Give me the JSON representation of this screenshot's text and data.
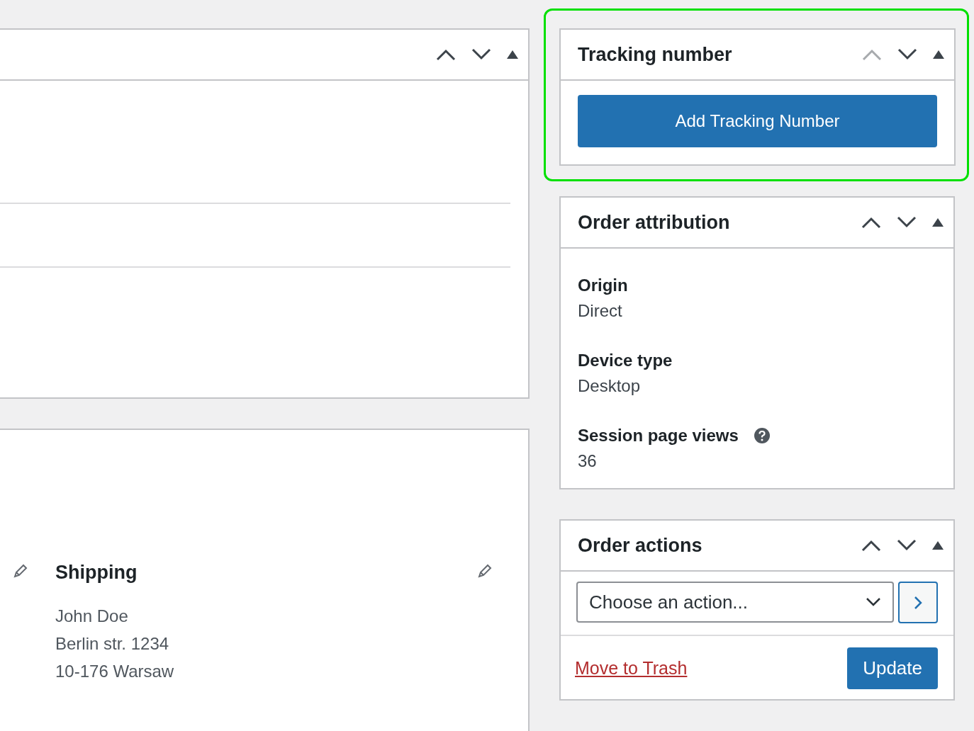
{
  "order_panel": {
    "move_up_disabled": false
  },
  "address_panel": {
    "shipping": {
      "heading": "Shipping",
      "lines": [
        "John Doe",
        "Berlin str. 1234",
        "10-176 Warsaw"
      ]
    }
  },
  "tracking": {
    "title": "Tracking number",
    "highlighted": true,
    "move_up_disabled": true,
    "button": "Add Tracking Number"
  },
  "attribution": {
    "title": "Order attribution",
    "move_up_disabled": false,
    "fields": [
      {
        "label": "Origin",
        "value": "Direct",
        "help": false
      },
      {
        "label": "Device type",
        "value": "Desktop",
        "help": false
      },
      {
        "label": "Session page views",
        "value": "36",
        "help": true
      }
    ]
  },
  "actions": {
    "title": "Order actions",
    "move_up_disabled": false,
    "select": "Choose an action...",
    "trash": "Move to Trash",
    "update": "Update"
  }
}
